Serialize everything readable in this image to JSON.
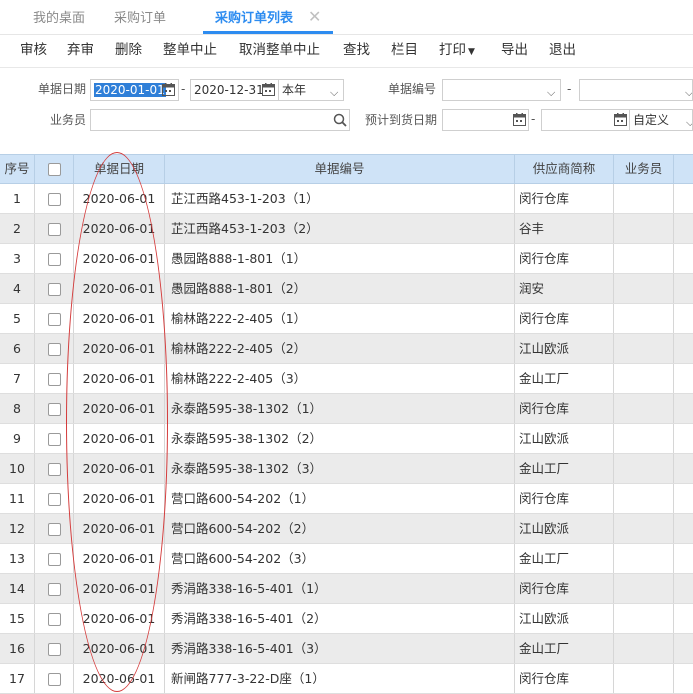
{
  "tabs": [
    {
      "label": "我的桌面"
    },
    {
      "label": "采购订单"
    },
    {
      "label": "采购订单列表"
    }
  ],
  "toolbar": {
    "audit": "审核",
    "abandon": "弃审",
    "delete": "删除",
    "stop_all": "整单中止",
    "cancel_stop_all": "取消整单中止",
    "search": "查找",
    "columns": "栏目",
    "print": "打印",
    "export": "导出",
    "exit": "退出"
  },
  "filters": {
    "date_label": "单据日期",
    "date_from": "2020-01-01",
    "date_to": "2020-12-31",
    "date_range": "本年",
    "code_label": "单据编号",
    "staff_label": "业务员",
    "expected_date_label": "预计到货日期",
    "expected_range": "自定义"
  },
  "grid": {
    "headers": {
      "index": "序号",
      "date": "单据日期",
      "code": "单据编号",
      "supplier": "供应商简称",
      "staff": "业务员"
    },
    "rows": [
      {
        "index": "1",
        "date": "2020-06-01",
        "code": "芷江西路453-1-203（1）",
        "supplier": "闵行仓库"
      },
      {
        "index": "2",
        "date": "2020-06-01",
        "code": "芷江西路453-1-203（2）",
        "supplier": "谷丰"
      },
      {
        "index": "3",
        "date": "2020-06-01",
        "code": "愚园路888-1-801（1）",
        "supplier": "闵行仓库"
      },
      {
        "index": "4",
        "date": "2020-06-01",
        "code": "愚园路888-1-801（2）",
        "supplier": "润安"
      },
      {
        "index": "5",
        "date": "2020-06-01",
        "code": "榆林路222-2-405（1）",
        "supplier": "闵行仓库"
      },
      {
        "index": "6",
        "date": "2020-06-01",
        "code": "榆林路222-2-405（2）",
        "supplier": "江山欧派"
      },
      {
        "index": "7",
        "date": "2020-06-01",
        "code": "榆林路222-2-405（3）",
        "supplier": "金山工厂"
      },
      {
        "index": "8",
        "date": "2020-06-01",
        "code": "永泰路595-38-1302（1）",
        "supplier": "闵行仓库"
      },
      {
        "index": "9",
        "date": "2020-06-01",
        "code": "永泰路595-38-1302（2）",
        "supplier": "江山欧派"
      },
      {
        "index": "10",
        "date": "2020-06-01",
        "code": "永泰路595-38-1302（3）",
        "supplier": "金山工厂"
      },
      {
        "index": "11",
        "date": "2020-06-01",
        "code": "营口路600-54-202（1）",
        "supplier": "闵行仓库"
      },
      {
        "index": "12",
        "date": "2020-06-01",
        "code": "营口路600-54-202（2）",
        "supplier": "江山欧派"
      },
      {
        "index": "13",
        "date": "2020-06-01",
        "code": "营口路600-54-202（3）",
        "supplier": "金山工厂"
      },
      {
        "index": "14",
        "date": "2020-06-01",
        "code": "秀涓路338-16-5-401（1）",
        "supplier": "闵行仓库"
      },
      {
        "index": "15",
        "date": "2020-06-01",
        "code": "秀涓路338-16-5-401（2）",
        "supplier": "江山欧派"
      },
      {
        "index": "16",
        "date": "2020-06-01",
        "code": "秀涓路338-16-5-401（3）",
        "supplier": "金山工厂"
      },
      {
        "index": "17",
        "date": "2020-06-01",
        "code": "新闸路777-3-22-D座（1）",
        "supplier": "闵行仓库"
      }
    ]
  },
  "colors": {
    "accent": "#2d8cf0",
    "header_bg": "#cfe3f7",
    "alt_row": "#ebebeb",
    "annotation": "#d43b3b"
  }
}
